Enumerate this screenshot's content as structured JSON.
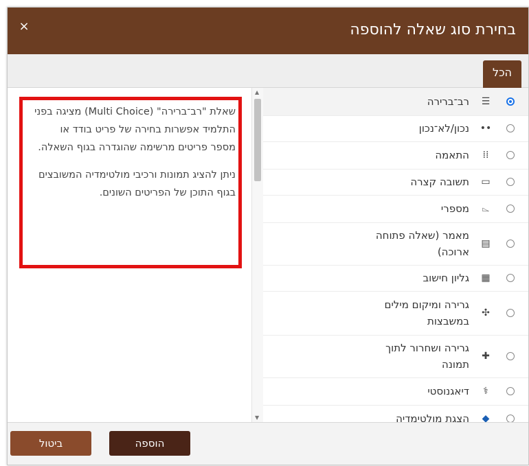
{
  "dialog": {
    "title": "בחירת סוג שאלה להוספה",
    "close_glyph": "×",
    "tab_all": "הכל"
  },
  "description": {
    "paragraph1": "שאלת \"רב־ברירה\" (Multi Choice) מציגה בפני התלמיד אפשרות בחירה של פריט בודד או מספר פריטים מרשימה שהוגדרה בגוף השאלה.",
    "paragraph2": "ניתן להציג תמונות ורכיבי מולטימדיה המשובצים בגוף התוכן של הפריטים השונים."
  },
  "question_types": [
    {
      "label": "רב־ברירה",
      "icon": "list-icon",
      "glyph": "☰",
      "selected": true
    },
    {
      "label": "נכון/לא־נכון",
      "icon": "two-dots-icon",
      "glyph": "••",
      "selected": false
    },
    {
      "label": "התאמה",
      "icon": "grid-dots-icon",
      "glyph": "⁞⁞",
      "selected": false
    },
    {
      "label": "תשובה קצרה",
      "icon": "input-box-icon",
      "glyph": "▭",
      "selected": false
    },
    {
      "label": "מספרי",
      "icon": "numeric-icon",
      "glyph": "⌳",
      "selected": false
    },
    {
      "label": "מאמר (שאלה פתוחה ארוכה)",
      "icon": "document-icon",
      "glyph": "▤",
      "selected": false
    },
    {
      "label": "גליון חישוב",
      "icon": "spreadsheet-icon",
      "glyph": "▦",
      "selected": false
    },
    {
      "label": "גרירה ומיקום מילים במשבצות",
      "icon": "drag-icon",
      "glyph": "✣",
      "selected": false
    },
    {
      "label": "גרירה ושחרור לתוך תמונה",
      "icon": "plus-move-icon",
      "glyph": "✚",
      "selected": false
    },
    {
      "label": "דיאגנוסטי",
      "icon": "stethoscope-icon",
      "glyph": "⚕",
      "selected": false
    },
    {
      "label": "הצגת מולטימדיה",
      "icon": "drop-icon",
      "glyph": "◆",
      "selected": false
    }
  ],
  "footer": {
    "add_label": "הוספה",
    "cancel_label": "ביטול"
  },
  "colors": {
    "header": "#6b3d22",
    "add_button": "#4a2417",
    "cancel_button": "#8a4b2c",
    "highlight_box": "#e21212",
    "radio_selected": "#1a73e8"
  }
}
